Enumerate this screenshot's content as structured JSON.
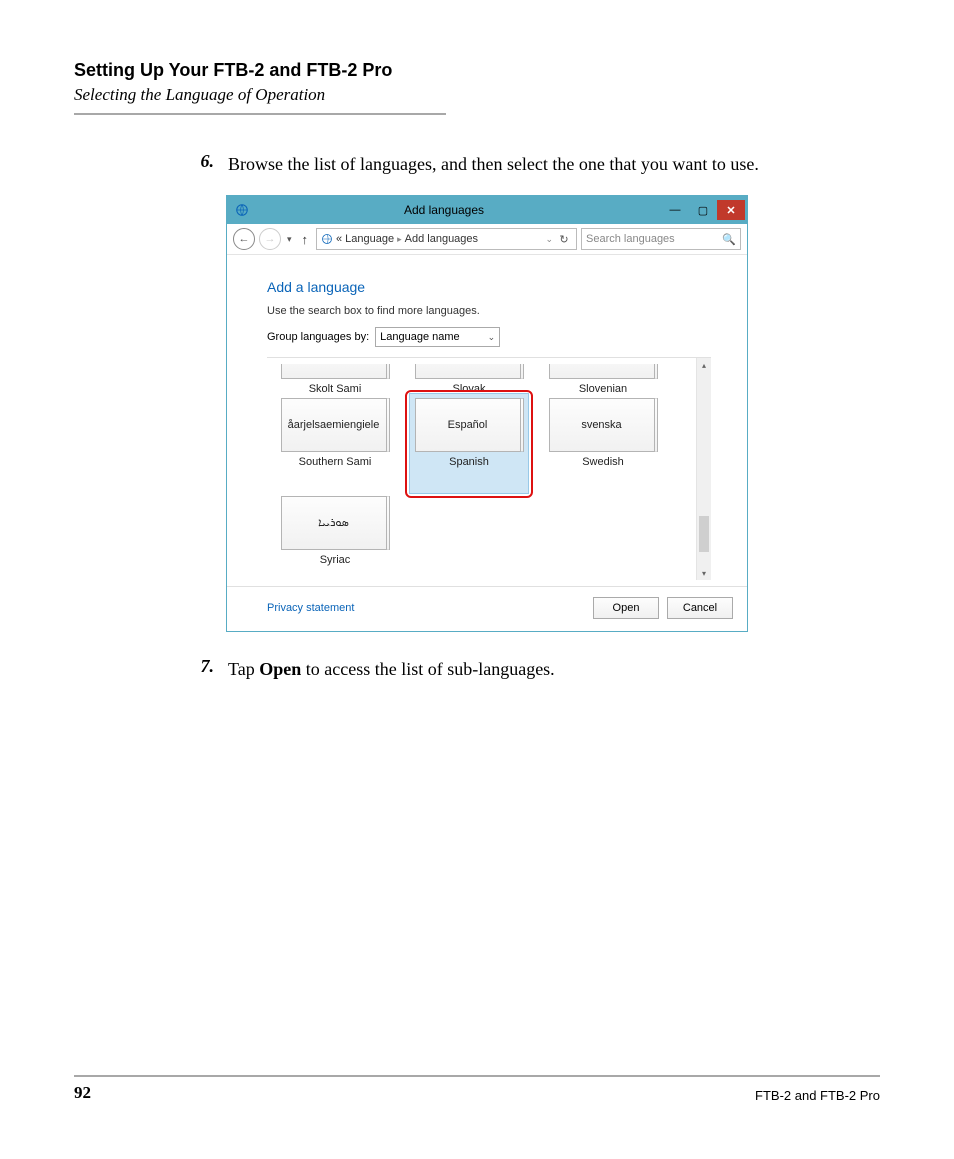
{
  "doc": {
    "title": "Setting Up Your FTB-2 and FTB-2 Pro",
    "subtitle": "Selecting the Language of Operation",
    "page_number": "92",
    "product": "FTB-2 and FTB-2 Pro"
  },
  "steps": {
    "s6": {
      "num": "6.",
      "text": "Browse the list of languages, and then select the one that you want to use."
    },
    "s7": {
      "num": "7.",
      "prefix": "Tap ",
      "bold": "Open",
      "suffix": " to access the list of sub-languages."
    }
  },
  "win": {
    "title": "Add languages",
    "breadcrumb": {
      "root": "«",
      "p1": "Language",
      "p2": "Add languages"
    },
    "search_placeholder": "Search languages",
    "heading": "Add a language",
    "subtext": "Use the search box to find more languages.",
    "group_label": "Group languages by:",
    "group_value": "Language name",
    "row1": {
      "a": "Skolt Sami",
      "b": "Slovak",
      "c": "Slovenian"
    },
    "row2": {
      "a": {
        "native": "åarjel­saemiengiele",
        "label": "Southern Sami"
      },
      "b": {
        "native": "Español",
        "label": "Spanish"
      },
      "c": {
        "native": "svenska",
        "label": "Swedish"
      }
    },
    "row3": {
      "a": {
        "native": "ܣܘܪܝܝܐ",
        "label": "Syriac"
      }
    },
    "privacy": "Privacy statement",
    "open": "Open",
    "cancel": "Cancel"
  }
}
